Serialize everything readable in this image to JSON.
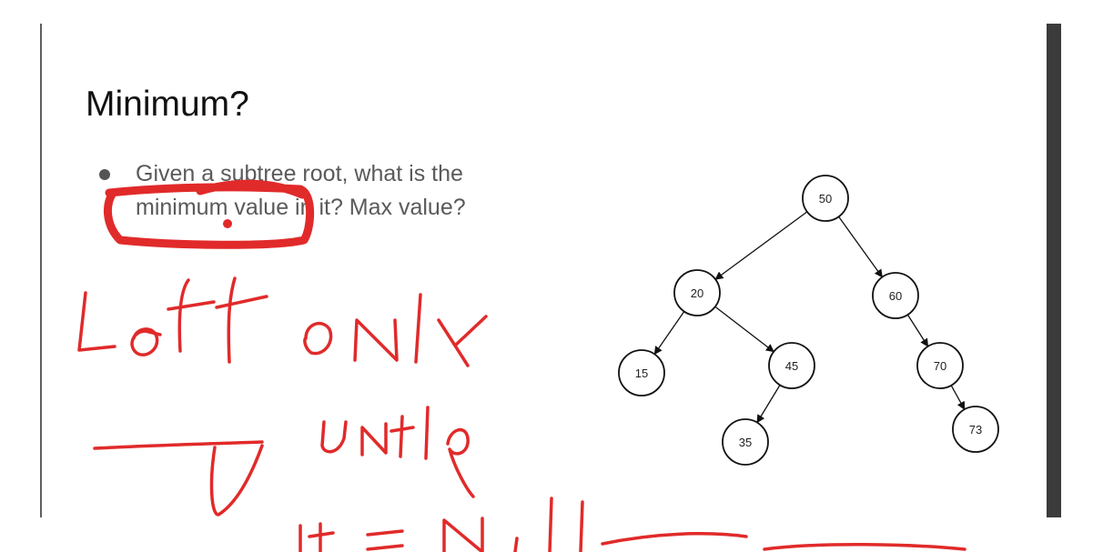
{
  "slide": {
    "title": "Minimum?",
    "bullet": "Given a subtree root, what is the minimum value in it? Max value?"
  },
  "tree": {
    "nodes": [
      {
        "id": "50",
        "label": "50"
      },
      {
        "id": "20",
        "label": "20"
      },
      {
        "id": "60",
        "label": "60"
      },
      {
        "id": "15",
        "label": "15"
      },
      {
        "id": "45",
        "label": "45"
      },
      {
        "id": "70",
        "label": "70"
      },
      {
        "id": "35",
        "label": "35"
      },
      {
        "id": "73",
        "label": "73"
      }
    ],
    "edges": [
      [
        "50",
        "20"
      ],
      [
        "50",
        "60"
      ],
      [
        "20",
        "15"
      ],
      [
        "20",
        "45"
      ],
      [
        "45",
        "35"
      ],
      [
        "60",
        "70"
      ],
      [
        "70",
        "73"
      ]
    ]
  },
  "annotations": {
    "ink_color": "#e12a2a",
    "lines": [
      "Left only",
      "until",
      "it = Null"
    ]
  }
}
